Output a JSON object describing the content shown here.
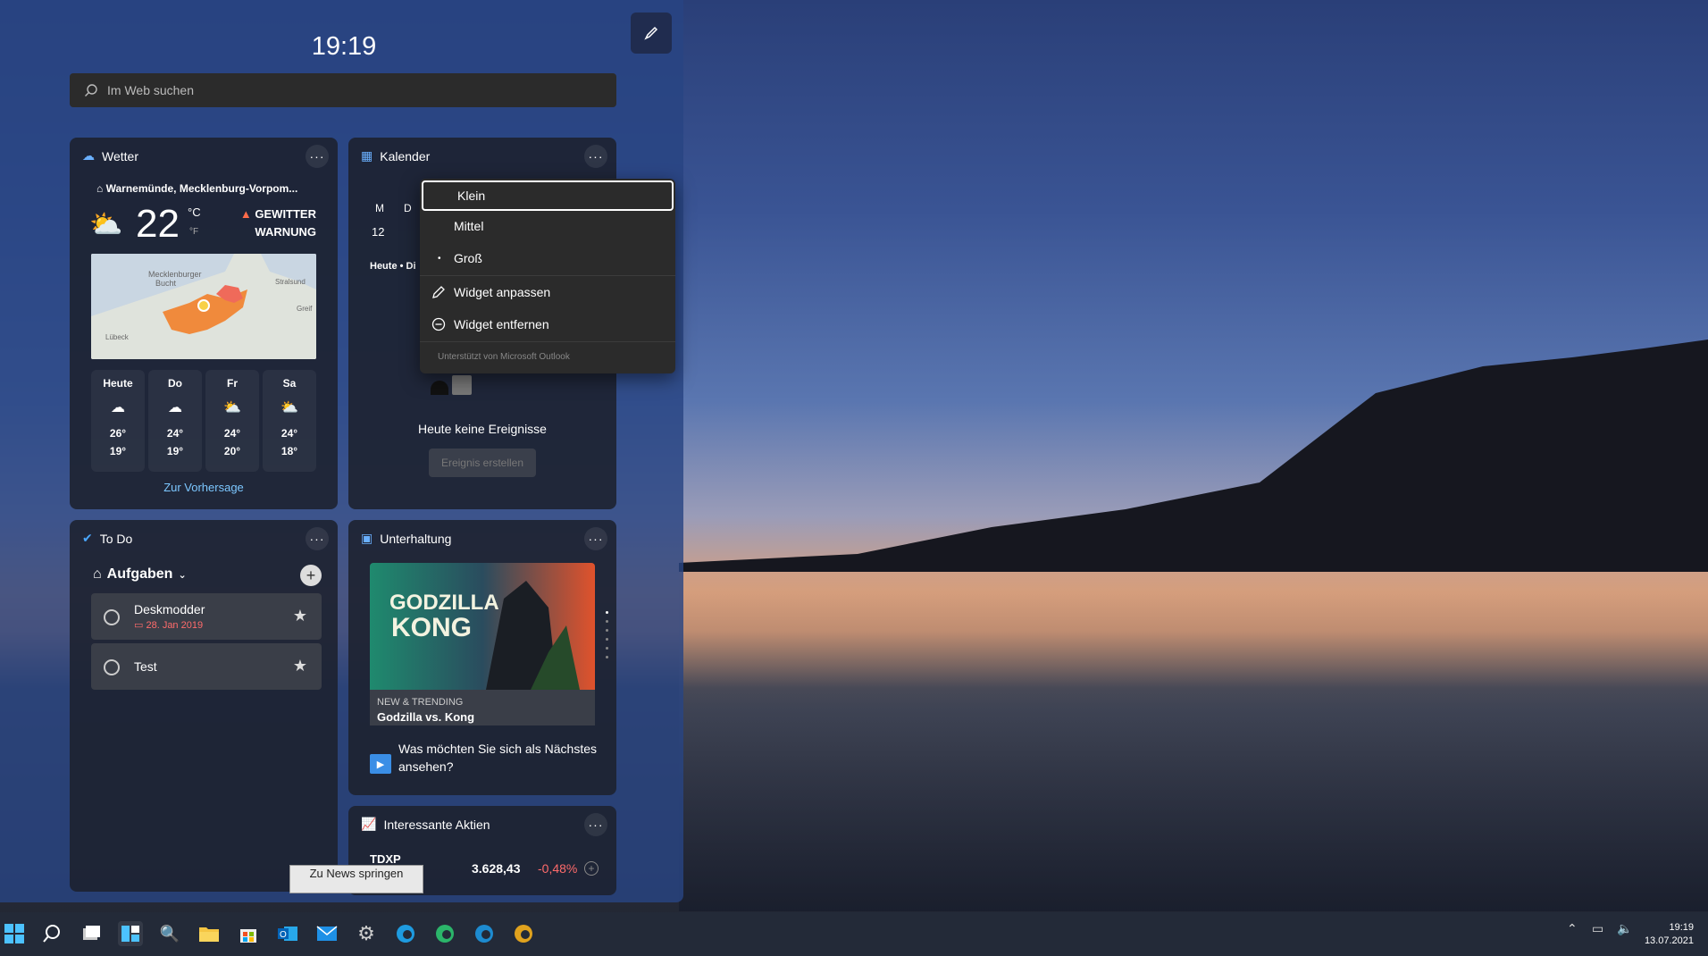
{
  "panel": {
    "time": "19:19",
    "search_placeholder": "Im Web suchen"
  },
  "weather": {
    "title": "Wetter",
    "location": "Warnemünde, Mecklenburg-Vorpom...",
    "temp": "22",
    "unit_c": "°C",
    "unit_f": "°F",
    "warning_line1": "GEWITTER",
    "warning_line2": "WARNUNG",
    "map_labels": [
      "Mecklenburger",
      "Bucht",
      "Stralsund",
      "Lübeck",
      "Greif"
    ],
    "forecast": [
      {
        "day": "Heute",
        "hi": "26°",
        "lo": "19°"
      },
      {
        "day": "Do",
        "hi": "24°",
        "lo": "19°"
      },
      {
        "day": "Fr",
        "hi": "24°",
        "lo": "20°"
      },
      {
        "day": "Sa",
        "hi": "24°",
        "lo": "18°"
      }
    ],
    "link": "Zur Vorhersage"
  },
  "calendar": {
    "title": "Kalender",
    "day_letter_1": "M",
    "day_letter_2": "D",
    "day_num": "12",
    "today_label": "Heute • Di",
    "empty": "Heute keine Ereignisse",
    "create_btn": "Ereignis erstellen"
  },
  "menu": {
    "klein": "Klein",
    "mittel": "Mittel",
    "gross": "Groß",
    "anpassen": "Widget anpassen",
    "entfernen": "Widget entfernen",
    "footer": "Unterstützt von Microsoft Outlook"
  },
  "todo": {
    "title": "To Do",
    "list": "Aufgaben",
    "tasks": [
      {
        "name": "Deskmodder",
        "date": "28. Jan 2019"
      },
      {
        "name": "Test",
        "date": ""
      }
    ]
  },
  "entertainment": {
    "title": "Unterhaltung",
    "poster_line1": "GODZILLA",
    "poster_line2": "KONG",
    "tag": "NEW & TRENDING",
    "headline": "Godzilla vs. Kong",
    "question": "Was möchten Sie sich als Nächstes ansehen?"
  },
  "stocks": {
    "title": "Interessante Aktien",
    "symbol": "TDXP",
    "value": "3.628,43",
    "change": "-0,48%"
  },
  "tooltip": "Zu News springen",
  "taskbar": {
    "time": "19:19",
    "date": "13.07.2021"
  },
  "colors": {
    "accent": "#7cc7ff",
    "negative": "#ff6b6b",
    "panel": "#2a4685"
  }
}
